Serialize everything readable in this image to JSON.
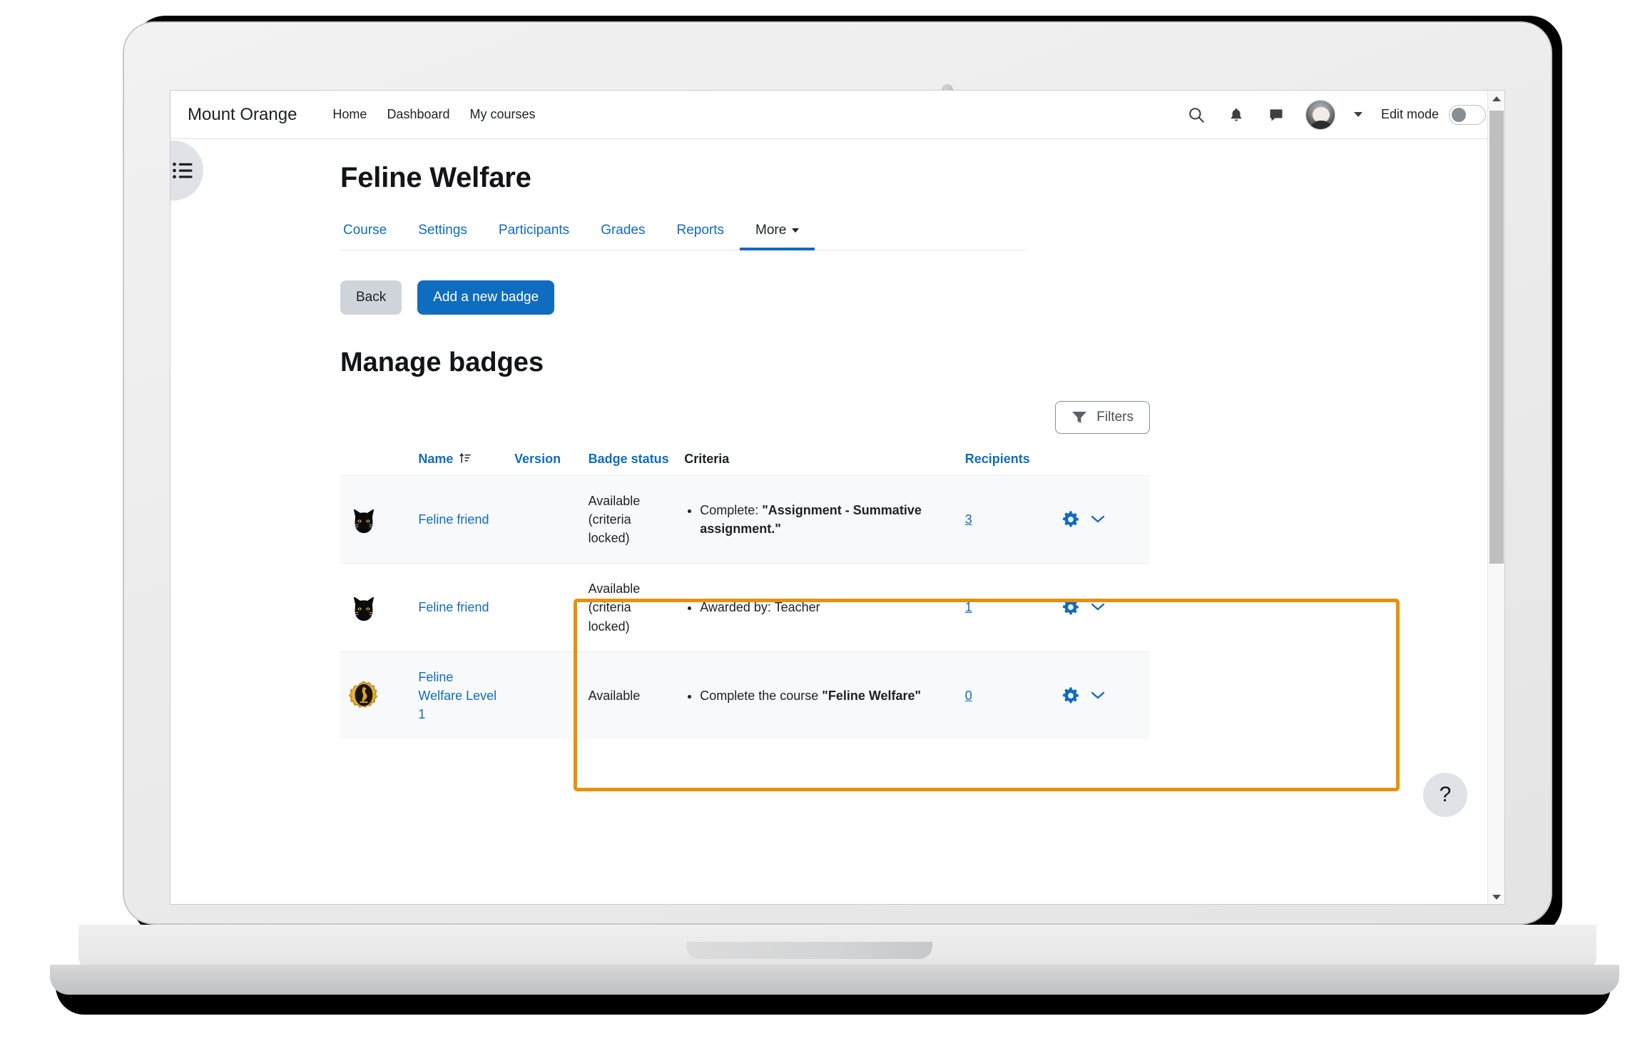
{
  "navbar": {
    "brand": "Mount Orange",
    "links": [
      {
        "label": "Home"
      },
      {
        "label": "Dashboard"
      },
      {
        "label": "My courses"
      }
    ],
    "icons": [
      "search-icon",
      "bell-icon",
      "message-icon"
    ],
    "edit_mode_label": "Edit mode",
    "edit_mode_on": false
  },
  "course": {
    "title": "Feline Welfare",
    "tabs": [
      {
        "label": "Course",
        "active": false
      },
      {
        "label": "Settings",
        "active": false
      },
      {
        "label": "Participants",
        "active": false
      },
      {
        "label": "Grades",
        "active": false
      },
      {
        "label": "Reports",
        "active": false
      },
      {
        "label": "More",
        "active": true,
        "has_caret": true
      }
    ]
  },
  "actions": {
    "back_label": "Back",
    "add_badge_label": "Add a new badge"
  },
  "page_heading": "Manage badges",
  "filters": {
    "label": "Filters",
    "icon": "funnel-icon"
  },
  "table": {
    "columns": [
      {
        "label": "",
        "key": "icon",
        "link": false
      },
      {
        "label": "Name",
        "key": "name",
        "link": true,
        "sort_icon": "sort-ascending-icon"
      },
      {
        "label": "Version",
        "key": "version",
        "link": true
      },
      {
        "label": "Badge status",
        "key": "status",
        "link": true
      },
      {
        "label": "Criteria",
        "key": "criteria",
        "link": false
      },
      {
        "label": "Recipients",
        "key": "recipients",
        "link": true
      },
      {
        "label": "",
        "key": "actions",
        "link": false
      }
    ],
    "rows": [
      {
        "badge_icon": "black-cat-badge-icon",
        "name": "Feline friend",
        "version": "",
        "status": "Available (criteria locked)",
        "criteria": [
          {
            "prefix": "Complete: ",
            "strong": "\"Assignment - Summative assignment.\""
          }
        ],
        "recipients": "3",
        "striped": true,
        "highlighted": true
      },
      {
        "badge_icon": "black-cat-badge-icon",
        "name": "Feline friend",
        "version": "",
        "status": "Available (criteria locked)",
        "criteria": [
          {
            "prefix": "Awarded by: Teacher",
            "strong": ""
          }
        ],
        "recipients": "1",
        "striped": false,
        "highlighted": true
      },
      {
        "badge_icon": "gold-cat-badge-icon",
        "name": "Feline Welfare Level 1",
        "version": "",
        "status": "Available",
        "criteria": [
          {
            "prefix": "Complete the course ",
            "strong": "\"Feline Welfare\""
          }
        ],
        "recipients": "0",
        "striped": true,
        "highlighted": false
      }
    ],
    "row_action_icons": [
      "gear-icon",
      "chevron-down-icon"
    ]
  },
  "help": {
    "label": "?"
  },
  "colors": {
    "link": "#0f6cbf",
    "primary_button": "#0f6cbf",
    "highlight_border": "#e8900c",
    "text": "#1d2125",
    "stripe": "#f8f9fa"
  }
}
